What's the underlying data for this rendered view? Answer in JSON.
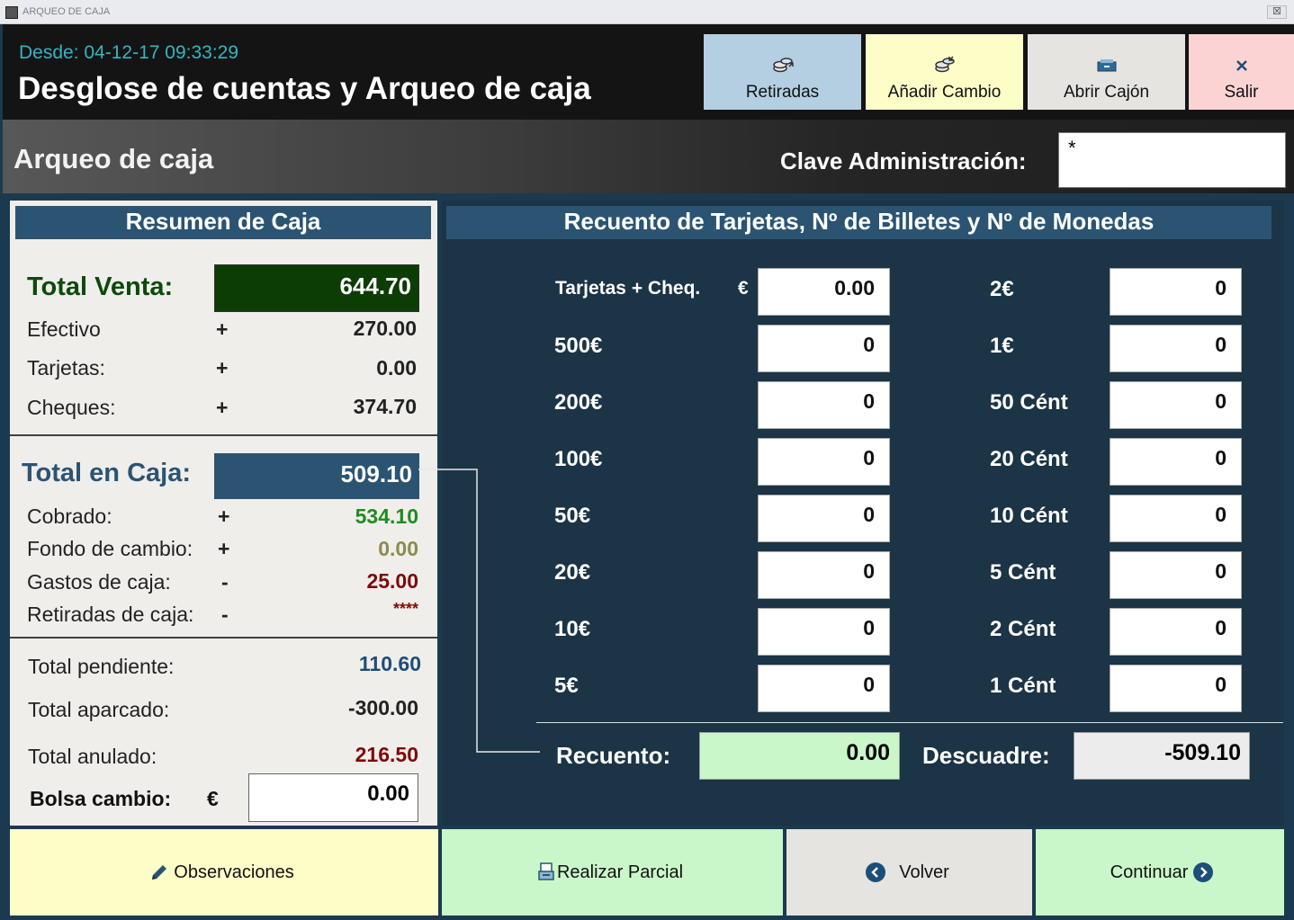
{
  "window": {
    "title": "ARQUEO DE CAJA",
    "close": "☒"
  },
  "header": {
    "since": "Desde: 04-12-17 09:33:29",
    "title": "Desglose de cuentas y Arqueo de caja",
    "buttons": {
      "retiradas": "Retiradas",
      "anadir_cambio": "Añadir Cambio",
      "abrir_cajon": "Abrir Cajón",
      "salir": "Salir"
    }
  },
  "subheader": {
    "title": "Arqueo de caja",
    "clave_label": "Clave Administración:",
    "clave_value": "*"
  },
  "resumen": {
    "title": "Resumen de Caja",
    "total_venta_label": "Total Venta:",
    "total_venta": "644.70",
    "efectivo_label": "Efectivo",
    "efectivo": "270.00",
    "tarjetas_label": "Tarjetas:",
    "tarjetas": "0.00",
    "cheques_label": "Cheques:",
    "cheques": "374.70",
    "plus": "+",
    "minus": "-",
    "total_caja_label": "Total en Caja:",
    "total_caja": "509.10",
    "cobrado_label": "Cobrado:",
    "cobrado": "534.10",
    "fondo_label": "Fondo de cambio:",
    "fondo": "0.00",
    "gastos_label": "Gastos de caja:",
    "gastos": "25.00",
    "retiradas_label": "Retiradas de caja:",
    "retiradas": "****",
    "pendiente_label": "Total pendiente:",
    "pendiente": "110.60",
    "aparcado_label": "Total aparcado:",
    "aparcado": "-300.00",
    "anulado_label": "Total anulado:",
    "anulado": "216.50",
    "bolsa_label": "Bolsa cambio:",
    "euro": "€",
    "bolsa": "0.00"
  },
  "recuento": {
    "title": "Recuento de Tarjetas, Nº de Billetes y Nº de Monedas",
    "tarjetas_label": "Tarjetas + Cheq.",
    "euro": "€",
    "tarjetas_value": "0.00",
    "left": [
      {
        "label": "500€",
        "value": "0"
      },
      {
        "label": "200€",
        "value": "0"
      },
      {
        "label": "100€",
        "value": "0"
      },
      {
        "label": "50€",
        "value": "0"
      },
      {
        "label": "20€",
        "value": "0"
      },
      {
        "label": "10€",
        "value": "0"
      },
      {
        "label": "5€",
        "value": "0"
      }
    ],
    "right": [
      {
        "label": "2€",
        "value": "0"
      },
      {
        "label": "1€",
        "value": "0"
      },
      {
        "label": "50 Cént",
        "value": "0"
      },
      {
        "label": "20 Cént",
        "value": "0"
      },
      {
        "label": "10 Cént",
        "value": "0"
      },
      {
        "label": "5 Cént",
        "value": "0"
      },
      {
        "label": "2 Cént",
        "value": "0"
      },
      {
        "label": "1 Cént",
        "value": "0"
      }
    ],
    "recuento_label": "Recuento:",
    "recuento_value": "0.00",
    "descuadre_label": "Descuadre:",
    "descuadre_value": "-509.10"
  },
  "footer": {
    "observaciones": "Observaciones",
    "parcial": "Realizar Parcial",
    "volver": "Volver",
    "continuar": "Continuar"
  },
  "colors": {
    "header_bg": "#141414",
    "banner": "#2b5472",
    "panel_dark": "#1b3446",
    "total_venta_bg": "#0c3d05",
    "green_text": "#1e8c1e",
    "olive_text": "#8c8c4b",
    "red_text": "#7c0a0a",
    "blue_text": "#1d4d7a"
  }
}
